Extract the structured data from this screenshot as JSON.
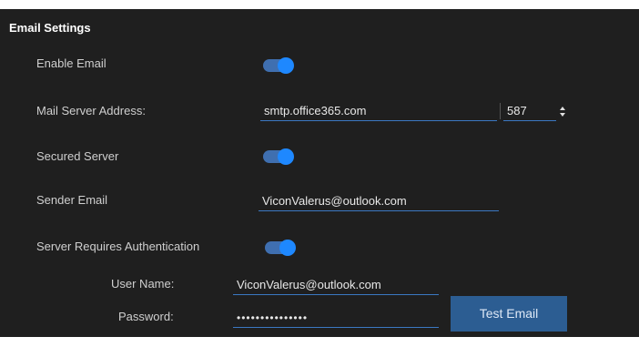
{
  "section": {
    "title": "Email Settings"
  },
  "fields": {
    "enable_email": {
      "label": "Enable Email",
      "on": true
    },
    "mail_server": {
      "label": "Mail Server Address:",
      "address": "smtp.office365.com",
      "port": "587"
    },
    "secured_server": {
      "label": "Secured Server",
      "on": true
    },
    "sender_email": {
      "label": "Sender Email",
      "value": "ViconValerus@outlook.com"
    },
    "server_auth": {
      "label": "Server Requires Authentication",
      "on": true
    },
    "user_name": {
      "label": "User Name:",
      "value": "ViconValerus@outlook.com"
    },
    "password": {
      "label": "Password:",
      "value": "•••••••••••••••"
    }
  },
  "actions": {
    "test_email": "Test Email"
  },
  "colors": {
    "panel_bg": "#1f1f1f",
    "accent": "#1e88ff",
    "toggle_track": "#3f6fb0",
    "button_bg": "#2c5d92"
  }
}
